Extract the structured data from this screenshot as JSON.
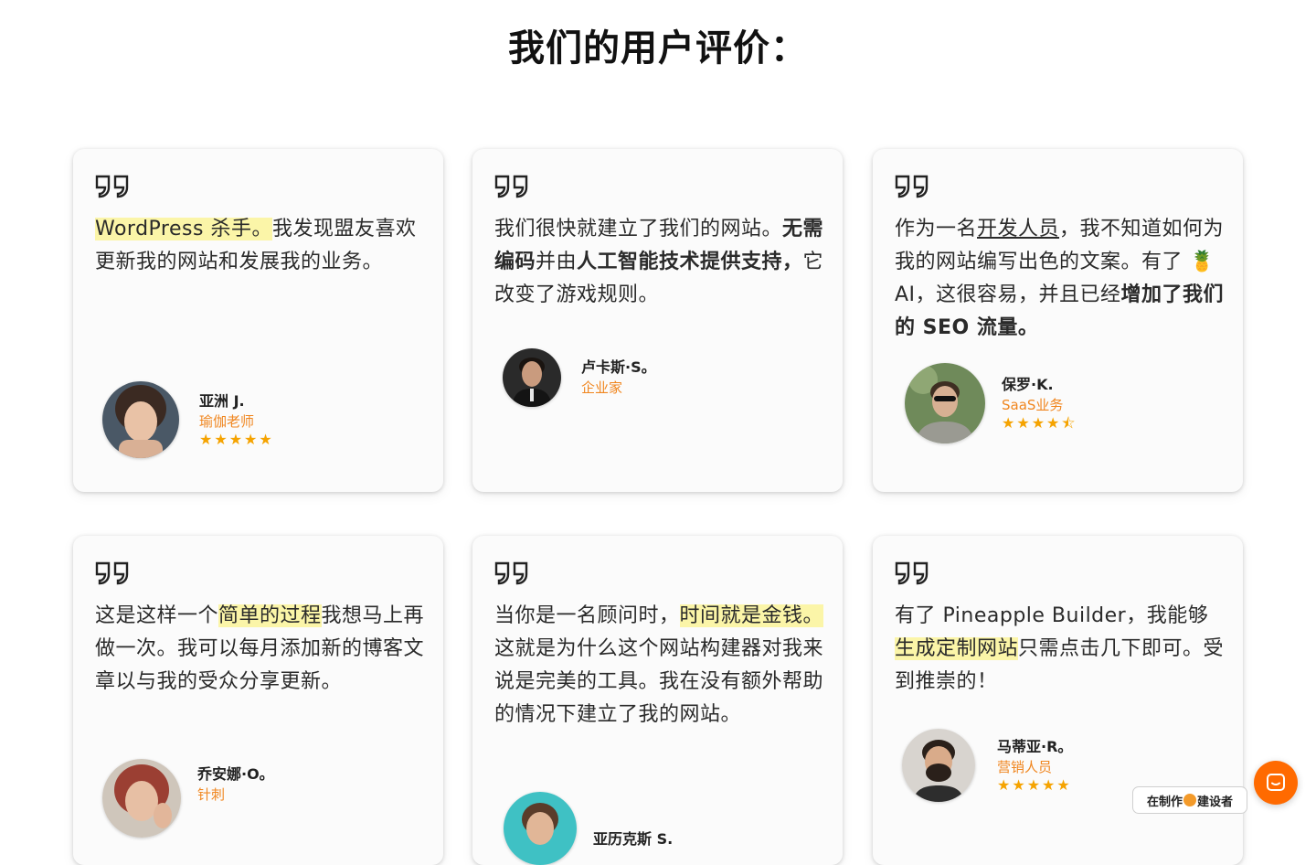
{
  "page": {
    "title": "我们的用户评价："
  },
  "testimonials": [
    {
      "segments": [
        {
          "t": "WordPress 杀手。",
          "s": "hl"
        },
        {
          "t": "我发现盟友喜欢更新我的网站和发展我的业务。",
          "s": ""
        }
      ],
      "author": "亚洲 J.",
      "role": "瑜伽老师",
      "stars": "★★★★★"
    },
    {
      "segments": [
        {
          "t": "我们很快就建立了我们的网站。",
          "s": ""
        },
        {
          "t": "无需编码",
          "s": "b"
        },
        {
          "t": "并由",
          "s": ""
        },
        {
          "t": "人工智能技术提供支持，",
          "s": "b"
        },
        {
          "t": "它改变了游戏规则。",
          "s": ""
        }
      ],
      "author": "卢卡斯·S。",
      "role": "企业家",
      "stars": ""
    },
    {
      "segments": [
        {
          "t": "作为一名",
          "s": ""
        },
        {
          "t": "开发人员",
          "s": "u"
        },
        {
          "t": "，我不知道如何为我的网站编写出色的文案。有了 🍍 AI，这很容易，并且已经",
          "s": ""
        },
        {
          "t": "增加了我们的 SEO 流量。",
          "s": "b"
        }
      ],
      "author": "保罗·K.",
      "role": "SaaS业务",
      "stars": "★★★★⯪"
    },
    {
      "segments": [
        {
          "t": "这是这样一个",
          "s": ""
        },
        {
          "t": "简单的过程",
          "s": "hl"
        },
        {
          "t": "我想马上再做一次。我可以每月添加新的博客文章以与我的受众分享更新。",
          "s": ""
        }
      ],
      "author": "乔安娜·O。",
      "role": "针刺",
      "stars": ""
    },
    {
      "segments": [
        {
          "t": "当你是一名顾问时，",
          "s": ""
        },
        {
          "t": "时间就是金钱。",
          "s": "hl"
        },
        {
          "t": " 这就是为什么这个网站构建器对我来说是完美的工具。我在没有额外帮助的情况下建立了我的网站。",
          "s": ""
        }
      ],
      "author": "亚历克斯 S.",
      "role": "",
      "stars": ""
    },
    {
      "segments": [
        {
          "t": "有了 Pineapple Builder，我能够",
          "s": ""
        },
        {
          "t": "生成定制网站",
          "s": "hl"
        },
        {
          "t": "只需点击几下即可。受到推崇的！",
          "s": ""
        }
      ],
      "author": "马蒂亚·R。",
      "role": "营销人员",
      "stars": "★★★★★"
    }
  ],
  "badge": {
    "prefix": "在制作",
    "suffix": "建设者"
  },
  "colors": {
    "accent": "#f0861f",
    "star": "#f5a300",
    "highlight": "#fbf5a8",
    "chat": "#ff6a00"
  }
}
